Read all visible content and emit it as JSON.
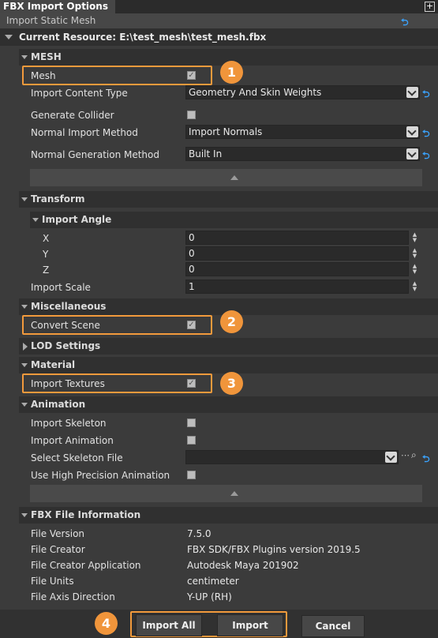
{
  "window": {
    "title": "FBX Import Options",
    "subtitle": "Import Static Mesh",
    "resource": "Current Resource: E:\\test_mesh\\test_mesh.fbx"
  },
  "sections": {
    "mesh": "MESH",
    "transform": "Transform",
    "import_angle": "Import Angle",
    "misc": "Miscellaneous",
    "lod": "LOD Settings",
    "material": "Material",
    "animation": "Animation",
    "fbx_info": "FBX File Information"
  },
  "mesh": {
    "mesh_label": "Mesh",
    "import_content_type_label": "Import Content Type",
    "import_content_type_value": "Geometry And Skin Weights",
    "generate_collider_label": "Generate Collider",
    "normal_import_method_label": "Normal Import Method",
    "normal_import_method_value": "Import Normals",
    "normal_generation_method_label": "Normal Generation Method",
    "normal_generation_method_value": "Built In"
  },
  "transform": {
    "x_label": "X",
    "x_value": "0",
    "y_label": "Y",
    "y_value": "0",
    "z_label": "Z",
    "z_value": "0",
    "scale_label": "Import Scale",
    "scale_value": "1"
  },
  "misc": {
    "convert_scene_label": "Convert Scene"
  },
  "material": {
    "import_textures_label": "Import Textures"
  },
  "animation": {
    "import_skeleton_label": "Import Skeleton",
    "import_animation_label": "Import Animation",
    "select_skeleton_label": "Select Skeleton File",
    "select_skeleton_value": "",
    "high_precision_label": "Use High Precision Animation"
  },
  "fbx_info": {
    "rows": [
      {
        "label": "File Version",
        "value": "7.5.0"
      },
      {
        "label": "File Creator",
        "value": "FBX SDK/FBX Plugins version 2019.5"
      },
      {
        "label": "File Creator Application",
        "value": "Autodesk Maya 201902"
      },
      {
        "label": "File Units",
        "value": "centimeter"
      },
      {
        "label": "File Axis Direction",
        "value": "Y-UP (RH)"
      }
    ]
  },
  "buttons": {
    "import_all": "Import All",
    "import": "Import",
    "cancel": "Cancel"
  },
  "badges": [
    "1",
    "2",
    "3",
    "4"
  ],
  "icons": {
    "reset": "reset-arrow-icon",
    "pin": "pin-icon",
    "browse": "ellipsis-icon",
    "search": "search-icon"
  },
  "colors": {
    "highlight": "#f29a3c",
    "badge": "#f0953b",
    "reset": "#3aa3ff"
  }
}
